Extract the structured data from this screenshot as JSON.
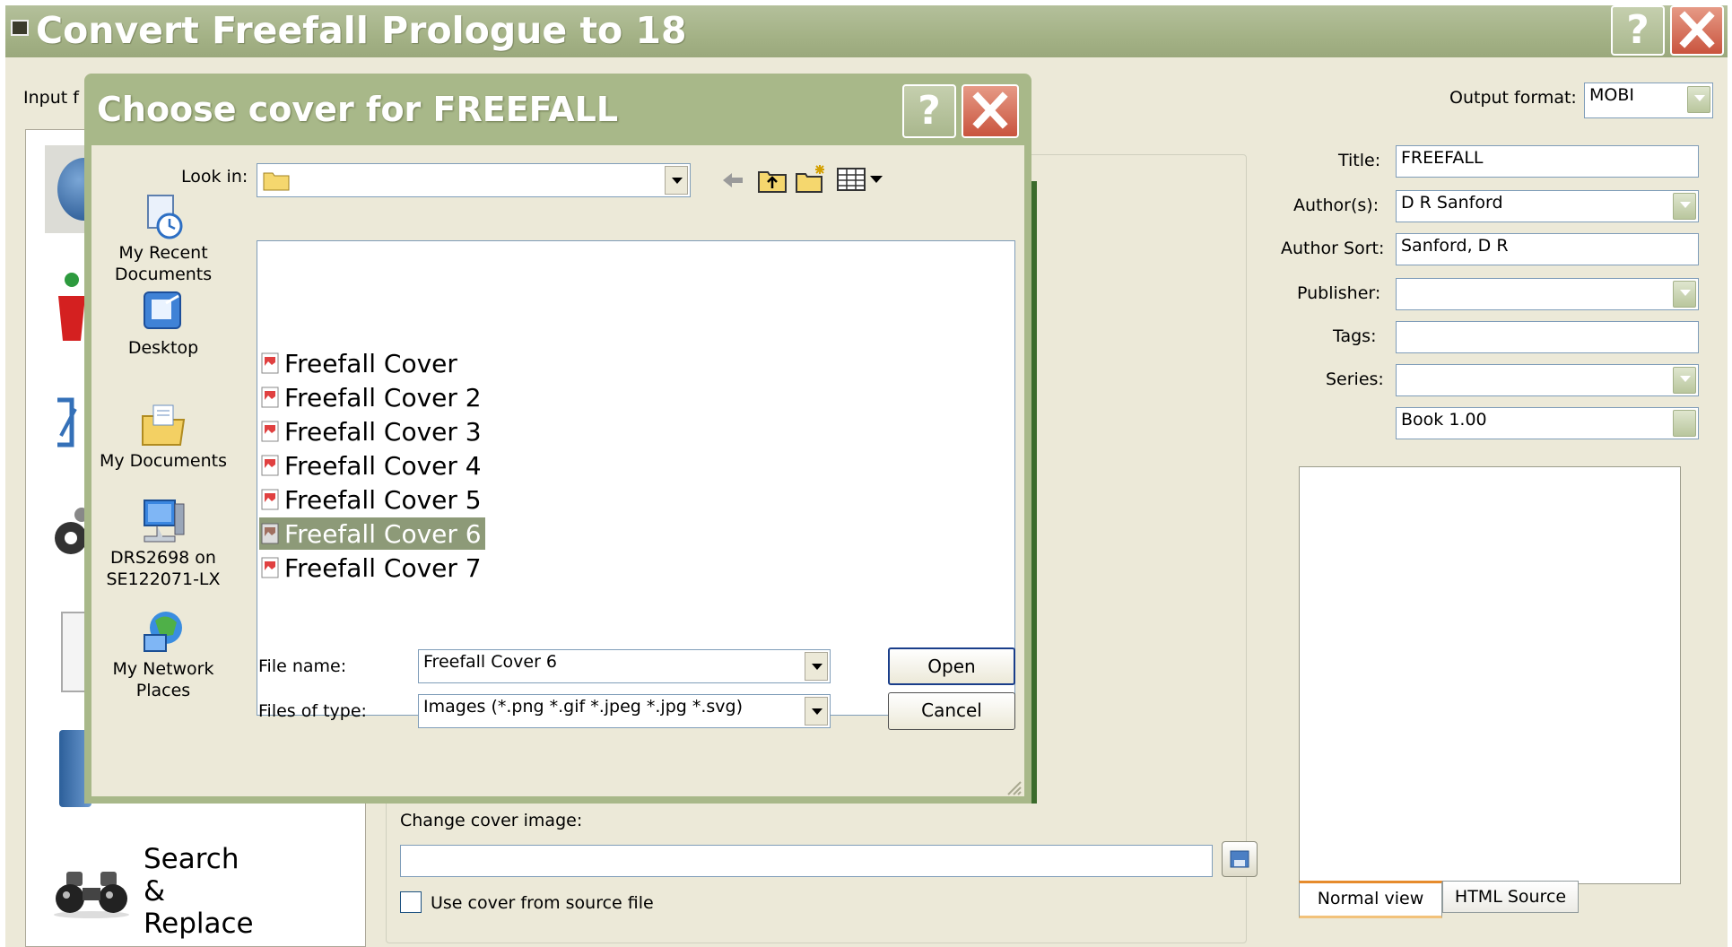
{
  "main_window": {
    "title": "Convert Freefall Prologue to 18",
    "help_label": "?",
    "input_format_label": "Input f",
    "output_format_label": "Output format:",
    "output_format_value": "MOBI"
  },
  "metadata": {
    "title_label": "Title:",
    "title_value": "FREEFALL",
    "authors_label": "Author(s):",
    "authors_value": "D R Sanford",
    "author_sort_label": "Author Sort:",
    "author_sort_value": "Sanford, D R",
    "publisher_label": "Publisher:",
    "publisher_value": "",
    "tags_label": "Tags:",
    "tags_value": "",
    "series_label": "Series:",
    "series_value": "",
    "series_index_value": "Book 1.00"
  },
  "cover": {
    "change_label": "Change cover image:",
    "path_value": "",
    "use_source_label": "Use cover from source file"
  },
  "comments_tabs": [
    "Normal view",
    "HTML Source"
  ],
  "sidebar": {
    "search_replace_lines": [
      "Search",
      "&",
      "Replace"
    ]
  },
  "dialog": {
    "title": "Choose cover for FREEFALL",
    "help_label": "?",
    "look_in_label": "Look in:",
    "look_in_value": "",
    "places": [
      {
        "label_lines": [
          "My Recent",
          "Documents"
        ],
        "icon": "recent-documents-icon"
      },
      {
        "label_lines": [
          "Desktop"
        ],
        "icon": "desktop-icon"
      },
      {
        "label_lines": [
          "My Documents"
        ],
        "icon": "my-documents-icon"
      },
      {
        "label_lines": [
          "DRS2698 on",
          "SE122071-LX"
        ],
        "icon": "network-drive-icon"
      },
      {
        "label_lines": [
          "My Network",
          "Places"
        ],
        "icon": "network-places-icon"
      }
    ],
    "files": [
      "Freefall Cover",
      "Freefall Cover 2",
      "Freefall Cover 3",
      "Freefall Cover 4",
      "Freefall Cover 5",
      "Freefall Cover 6",
      "Freefall Cover 7"
    ],
    "selected_file": "Freefall Cover 6",
    "file_name_label": "File name:",
    "file_name_value": "Freefall Cover 6",
    "files_of_type_label": "Files of type:",
    "files_of_type_value": "Images (*.png *.gif *.jpeg *.jpg *.svg)",
    "open_label": "Open",
    "cancel_label": "Cancel"
  },
  "colors": {
    "title_bar": "#a4b286",
    "window_bg": "#ece9d8",
    "close_red": "#c9543e",
    "selection": "#8d9a78"
  }
}
